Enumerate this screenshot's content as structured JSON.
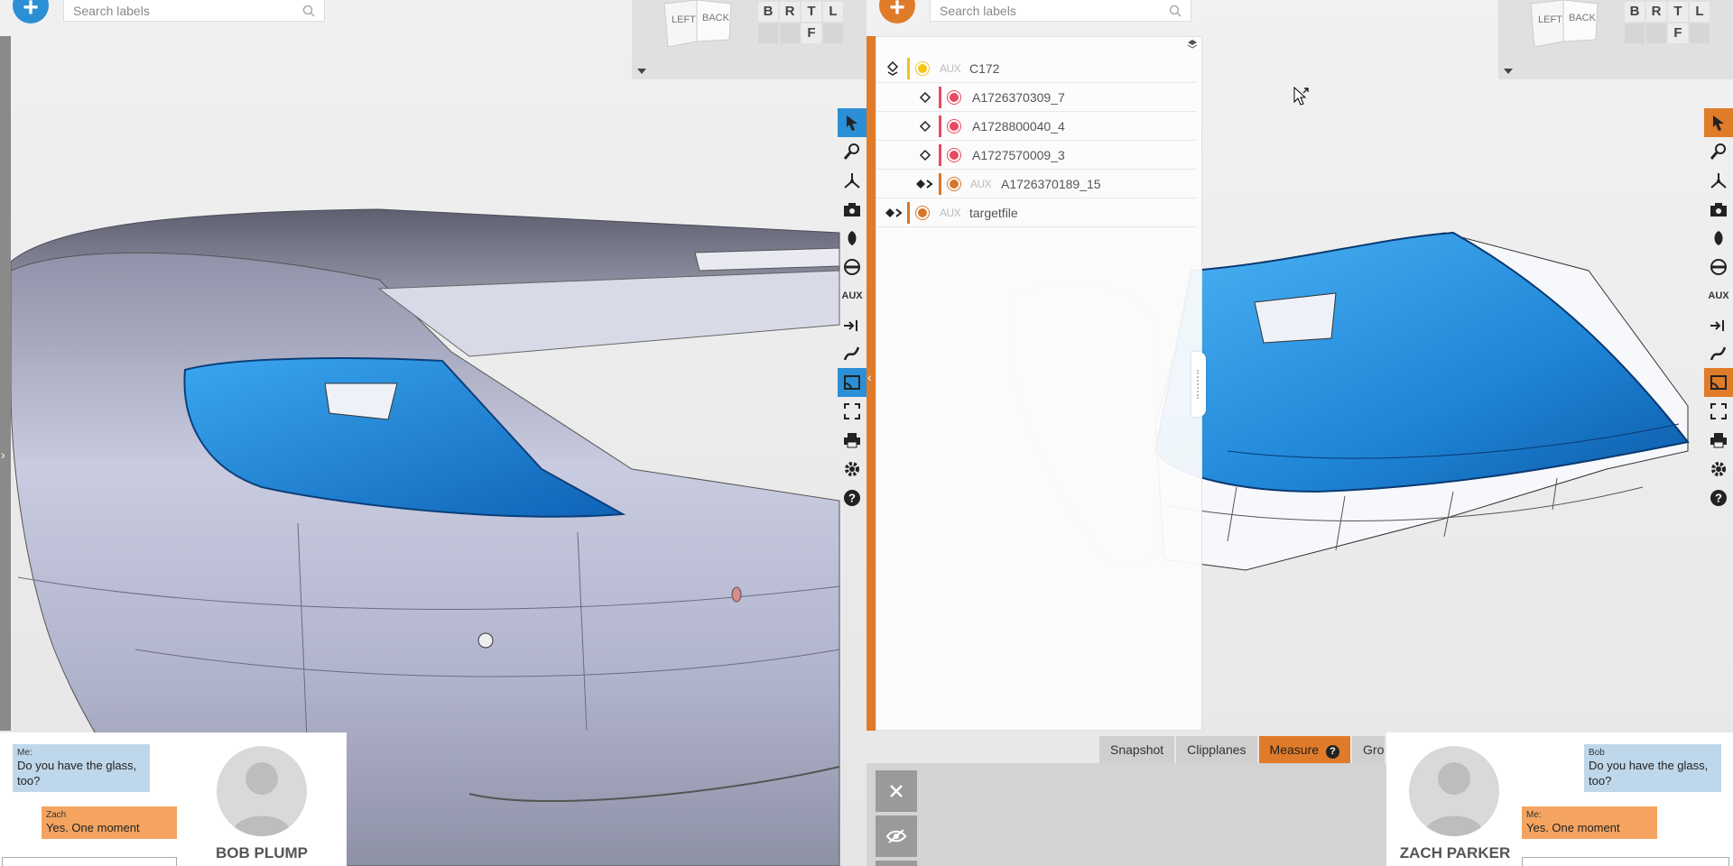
{
  "left_view": {
    "search": {
      "placeholder": "Search labels"
    },
    "viewcube": {
      "left_label": "LEFT",
      "back_label": "BACK",
      "faces": [
        "B",
        "R",
        "T",
        "L",
        "",
        "",
        "F",
        ""
      ]
    },
    "toolbar": {
      "active_color": "#2b8fd6",
      "tools": [
        "select-arrow-icon",
        "magnifier-icon",
        "axes-icon",
        "camera-icon",
        "material-icon",
        "ruler-icon",
        "AUX",
        "section-icon",
        "spline-icon",
        "cast-icon",
        "fullscreen-icon",
        "print-icon",
        "settings-gear-icon",
        "help-icon"
      ]
    },
    "chat": {
      "messages": [
        {
          "sender": "Me:",
          "text": "Do you have the glass, too?",
          "style": "me"
        },
        {
          "sender": "Zach",
          "text": "Yes. One moment",
          "style": "other"
        }
      ],
      "user_name": "BOB PLUMP"
    }
  },
  "right_view": {
    "search": {
      "placeholder": "Search labels"
    },
    "viewcube": {
      "left_label": "LEFT",
      "back_label": "BACK",
      "faces": [
        "B",
        "R",
        "T",
        "L",
        "",
        "",
        "F",
        ""
      ]
    },
    "toolbar": {
      "active_color": "#e07b2a"
    },
    "tree": {
      "rows": [
        {
          "label": "C172",
          "aux": "AUX",
          "dot": "#f0c419",
          "bar": "#f0c419",
          "level": 0
        },
        {
          "label": "A1726370309_7",
          "aux": "",
          "dot": "#e84a5f",
          "bar": "#e84a5f",
          "level": 1
        },
        {
          "label": "A1728800040_4",
          "aux": "",
          "dot": "#e84a5f",
          "bar": "#e84a5f",
          "level": 1
        },
        {
          "label": "A1727570009_3",
          "aux": "",
          "dot": "#e84a5f",
          "bar": "#e84a5f",
          "level": 1
        },
        {
          "label": "A1726370189_15",
          "aux": "AUX",
          "dot": "#d9762b",
          "bar": "#d9762b",
          "level": 1
        },
        {
          "label": "targetfile",
          "aux": "AUX",
          "dot": "#d9762b",
          "bar": "#d9762b",
          "level": 0
        }
      ]
    },
    "bottom_tabs": [
      {
        "label": "Snapshot",
        "active": false
      },
      {
        "label": "Clipplanes",
        "active": false
      },
      {
        "label": "Measure",
        "active": true,
        "help": "?"
      },
      {
        "label": "Gro",
        "active": false
      }
    ],
    "chat": {
      "messages": [
        {
          "sender": "Bob",
          "text": "Do you have the glass, too?",
          "style": "me"
        },
        {
          "sender": "Me:",
          "text": "Yes. One moment",
          "style": "other"
        }
      ],
      "user_name": "ZACH PARKER"
    }
  },
  "colors": {
    "left_accent": "#2b8fd6",
    "right_accent": "#e07b2a",
    "model_blue": "#1f86d8",
    "model_silver": "#b9bdd3"
  }
}
